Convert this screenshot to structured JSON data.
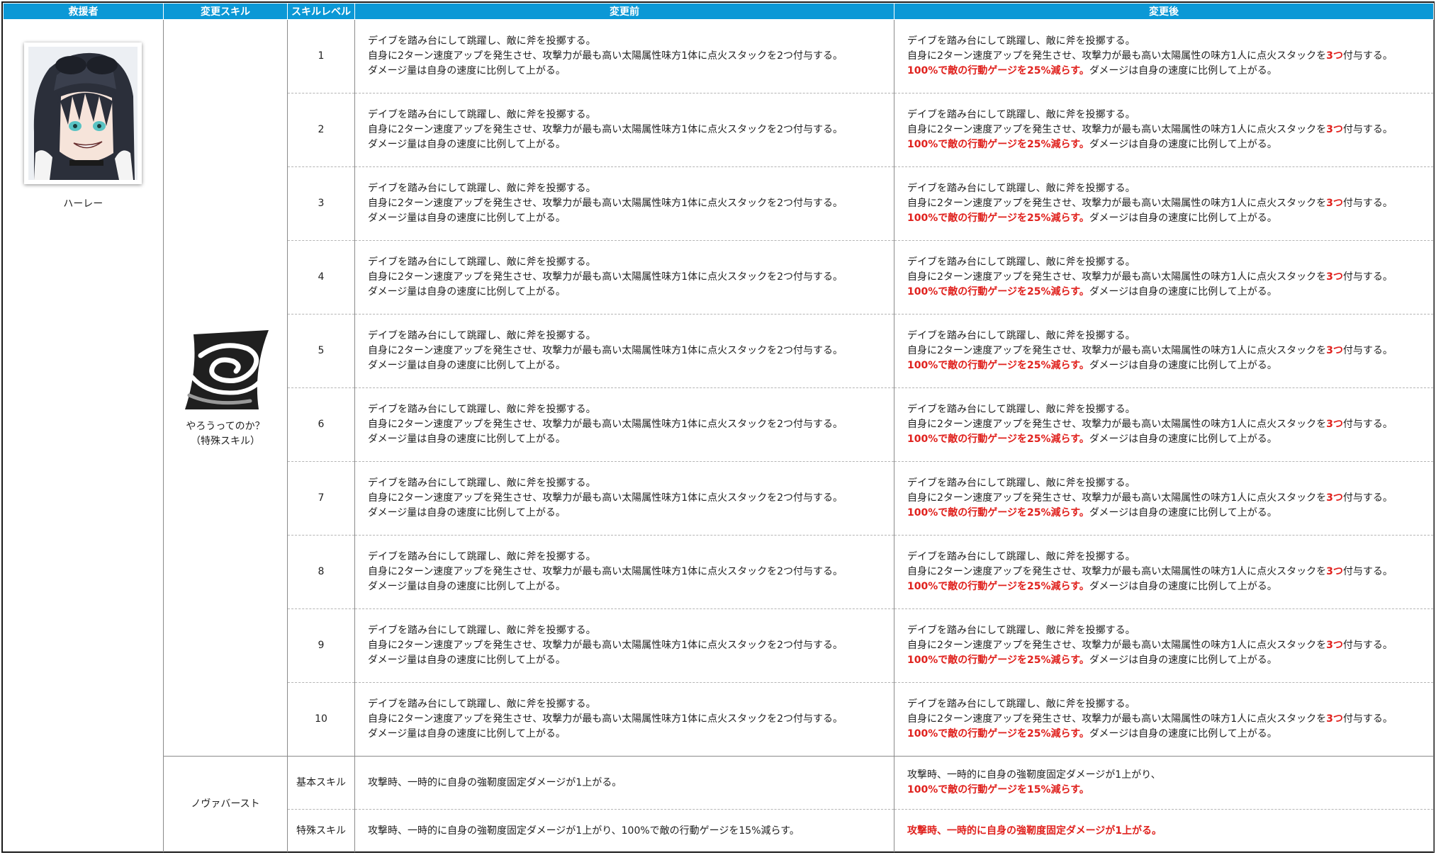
{
  "headers": {
    "rescuer": "救援者",
    "changed_skill": "変更スキル",
    "skill_level": "スキルレベル",
    "before": "変更前",
    "after": "変更後"
  },
  "rescuer": {
    "name": "ハーレー",
    "portrait_icon": "character-portrait"
  },
  "special_skill": {
    "icon": "swirl-skill-icon",
    "name_line1": "やろうってのか？",
    "name_line2": "（特殊スキル）"
  },
  "levels": [
    {
      "level": "1",
      "before": [
        "デイブを踏み台にして跳躍し、敵に斧を投擲する。",
        "自身に2ターン速度アップを発生させ、攻撃力が最も高い太陽属性味方1体に点火スタックを2つ付与する。",
        "ダメージ量は自身の速度に比例して上がる。"
      ],
      "after_line1": "デイブを踏み台にして跳躍し、敵に斧を投擲する。",
      "after_line2_pre": "自身に2ターン速度アップを発生させ、攻撃力が最も高い太陽属性の味方1人に点火スタックを",
      "after_line2_red": "3つ",
      "after_line2_post": "付与する。",
      "after_line3_red": "100%で敵の行動ゲージを25%減らす。",
      "after_line3_post": "ダメージは自身の速度に比例して上がる。"
    },
    {
      "level": "2",
      "before": [
        "デイブを踏み台にして跳躍し、敵に斧を投擲する。",
        "自身に2ターン速度アップを発生させ、攻撃力が最も高い太陽属性味方1体に点火スタックを2つ付与する。",
        "ダメージ量は自身の速度に比例して上がる。"
      ],
      "after_line1": "デイブを踏み台にして跳躍し、敵に斧を投擲する。",
      "after_line2_pre": "自身に2ターン速度アップを発生させ、攻撃力が最も高い太陽属性の味方1人に点火スタックを",
      "after_line2_red": "3つ",
      "after_line2_post": "付与する。",
      "after_line3_red": "100%で敵の行動ゲージを25%減らす。",
      "after_line3_post": "ダメージは自身の速度に比例して上がる。"
    },
    {
      "level": "3",
      "before": [
        "デイブを踏み台にして跳躍し、敵に斧を投擲する。",
        "自身に2ターン速度アップを発生させ、攻撃力が最も高い太陽属性味方1体に点火スタックを2つ付与する。",
        "ダメージ量は自身の速度に比例して上がる。"
      ],
      "after_line1": "デイブを踏み台にして跳躍し、敵に斧を投擲する。",
      "after_line2_pre": "自身に2ターン速度アップを発生させ、攻撃力が最も高い太陽属性の味方1人に点火スタックを",
      "after_line2_red": "3つ",
      "after_line2_post": "付与する。",
      "after_line3_red": "100%で敵の行動ゲージを25%減らす。",
      "after_line3_post": "ダメージは自身の速度に比例して上がる。"
    },
    {
      "level": "4",
      "before": [
        "デイブを踏み台にして跳躍し、敵に斧を投擲する。",
        "自身に2ターン速度アップを発生させ、攻撃力が最も高い太陽属性味方1体に点火スタックを2つ付与する。",
        "ダメージ量は自身の速度に比例して上がる。"
      ],
      "after_line1": "デイブを踏み台にして跳躍し、敵に斧を投擲する。",
      "after_line2_pre": "自身に2ターン速度アップを発生させ、攻撃力が最も高い太陽属性の味方1人に点火スタックを",
      "after_line2_red": "3つ",
      "after_line2_post": "付与する。",
      "after_line3_red": "100%で敵の行動ゲージを25%減らす。",
      "after_line3_post": "ダメージは自身の速度に比例して上がる。"
    },
    {
      "level": "5",
      "before": [
        "デイブを踏み台にして跳躍し、敵に斧を投擲する。",
        "自身に2ターン速度アップを発生させ、攻撃力が最も高い太陽属性味方1体に点火スタックを2つ付与する。",
        "ダメージ量は自身の速度に比例して上がる。"
      ],
      "after_line1": "デイブを踏み台にして跳躍し、敵に斧を投擲する。",
      "after_line2_pre": "自身に2ターン速度アップを発生させ、攻撃力が最も高い太陽属性の味方1人に点火スタックを",
      "after_line2_red": "3つ",
      "after_line2_post": "付与する。",
      "after_line3_red": "100%で敵の行動ゲージを25%減らす。",
      "after_line3_post": "ダメージは自身の速度に比例して上がる。"
    },
    {
      "level": "6",
      "before": [
        "デイブを踏み台にして跳躍し、敵に斧を投擲する。",
        "自身に2ターン速度アップを発生させ、攻撃力が最も高い太陽属性味方1体に点火スタックを2つ付与する。",
        "ダメージ量は自身の速度に比例して上がる。"
      ],
      "after_line1": "デイブを踏み台にして跳躍し、敵に斧を投擲する。",
      "after_line2_pre": "自身に2ターン速度アップを発生させ、攻撃力が最も高い太陽属性の味方1人に点火スタックを",
      "after_line2_red": "3つ",
      "after_line2_post": "付与する。",
      "after_line3_red": "100%で敵の行動ゲージを25%減らす。",
      "after_line3_post": "ダメージは自身の速度に比例して上がる。"
    },
    {
      "level": "7",
      "before": [
        "デイブを踏み台にして跳躍し、敵に斧を投擲する。",
        "自身に2ターン速度アップを発生させ、攻撃力が最も高い太陽属性味方1体に点火スタックを2つ付与する。",
        "ダメージ量は自身の速度に比例して上がる。"
      ],
      "after_line1": "デイブを踏み台にして跳躍し、敵に斧を投擲する。",
      "after_line2_pre": "自身に2ターン速度アップを発生させ、攻撃力が最も高い太陽属性の味方1人に点火スタックを",
      "after_line2_red": "3つ",
      "after_line2_post": "付与する。",
      "after_line3_red": "100%で敵の行動ゲージを25%減らす。",
      "after_line3_post": "ダメージは自身の速度に比例して上がる。"
    },
    {
      "level": "8",
      "before": [
        "デイブを踏み台にして跳躍し、敵に斧を投擲する。",
        "自身に2ターン速度アップを発生させ、攻撃力が最も高い太陽属性味方1体に点火スタックを2つ付与する。",
        "ダメージ量は自身の速度に比例して上がる。"
      ],
      "after_line1": "デイブを踏み台にして跳躍し、敵に斧を投擲する。",
      "after_line2_pre": "自身に2ターン速度アップを発生させ、攻撃力が最も高い太陽属性の味方1人に点火スタックを",
      "after_line2_red": "3つ",
      "after_line2_post": "付与する。",
      "after_line3_red": "100%で敵の行動ゲージを25%減らす。",
      "after_line3_post": "ダメージは自身の速度に比例して上がる。"
    },
    {
      "level": "9",
      "before": [
        "デイブを踏み台にして跳躍し、敵に斧を投擲する。",
        "自身に2ターン速度アップを発生させ、攻撃力が最も高い太陽属性味方1体に点火スタックを2つ付与する。",
        "ダメージ量は自身の速度に比例して上がる。"
      ],
      "after_line1": "デイブを踏み台にして跳躍し、敵に斧を投擲する。",
      "after_line2_pre": "自身に2ターン速度アップを発生させ、攻撃力が最も高い太陽属性の味方1人に点火スタックを",
      "after_line2_red": "3つ",
      "after_line2_post": "付与する。",
      "after_line3_red": "100%で敵の行動ゲージを25%減らす。",
      "after_line3_post": "ダメージは自身の速度に比例して上がる。"
    },
    {
      "level": "10",
      "before": [
        "デイブを踏み台にして跳躍し、敵に斧を投擲する。",
        "自身に2ターン速度アップを発生させ、攻撃力が最も高い太陽属性味方1体に点火スタックを2つ付与する。",
        "ダメージ量は自身の速度に比例して上がる。"
      ],
      "after_line1": "デイブを踏み台にして跳躍し、敵に斧を投擲する。",
      "after_line2_pre": "自身に2ターン速度アップを発生させ、攻撃力が最も高い太陽属性の味方1人に点火スタックを",
      "after_line2_red": "3つ",
      "after_line2_post": "付与する。",
      "after_line3_red": "100%で敵の行動ゲージを25%減らす。",
      "after_line3_post": "ダメージは自身の速度に比例して上がる。"
    }
  ],
  "nova_burst": {
    "name": "ノヴァバースト",
    "basic": {
      "label": "基本スキル",
      "before": "攻撃時、一時的に自身の強靭度固定ダメージが1上がる。",
      "after_line1": "攻撃時、一時的に自身の強靭度固定ダメージが1上がり、",
      "after_line2_red": "100%で敵の行動ゲージを15%減らす。"
    },
    "special": {
      "label": "特殊スキル",
      "before": "攻撃時、一時的に自身の強靭度固定ダメージが1上がり、100%で敵の行動ゲージを15%減らす。",
      "after_red": "攻撃時、一時的に自身の強靭度固定ダメージが1上がる。"
    }
  },
  "colors": {
    "header_bg": "#0b98d6",
    "header_text": "#ffffff",
    "highlight_red": "#e0211d"
  }
}
